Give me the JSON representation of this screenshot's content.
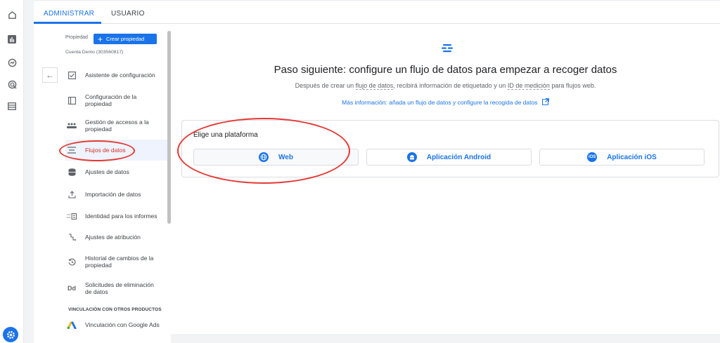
{
  "tabs": {
    "admin": "ADMINISTRAR",
    "user": "USUARIO"
  },
  "property": {
    "label": "Propiedad",
    "create_button": "Crear propiedad",
    "account": "Cuenta Demo (303560817)"
  },
  "menu": [
    {
      "label": "Asistente de configuración",
      "icon": "checkbox-icon"
    },
    {
      "label": "Configuración de la propiedad",
      "icon": "property-window-icon"
    },
    {
      "label": "Gestión de accesos a la propiedad",
      "icon": "people-icon"
    },
    {
      "label": "Flujos de datos",
      "icon": "data-streams-icon"
    },
    {
      "label": "Ajustes de datos",
      "icon": "database-icon"
    },
    {
      "label": "Importación de datos",
      "icon": "upload-icon"
    },
    {
      "label": "Identidad para los informes",
      "icon": "identity-icon"
    },
    {
      "label": "Ajustes de atribución",
      "icon": "attribution-icon"
    },
    {
      "label": "Historial de cambios de la propiedad",
      "icon": "history-icon"
    },
    {
      "label": "Solicitudes de eliminación de datos",
      "icon": "dd-icon"
    }
  ],
  "linking": {
    "section_title": "VINCULACIÓN CON OTROS PRODUCTOS",
    "google_ads": "Vinculación con Google Ads"
  },
  "main": {
    "headline": "Paso siguiente: configure un flujo de datos para empezar a recoger datos",
    "sub_before": "Después de crear un ",
    "sub_term1": "flujo de datos",
    "sub_middle": ", recibirá información de etiquetado y un ",
    "sub_term2": "ID de medición",
    "sub_after": " para flujos web.",
    "more_link": "Más información: añada un flujo de datos y configure la recogida de datos",
    "platform_title": "Elige una plataforma",
    "platforms": {
      "web": "Web",
      "android": "Aplicación Android",
      "ios": "Aplicación iOS",
      "ios_badge": "iOS"
    }
  },
  "colors": {
    "accent": "#1a73e8",
    "annotation": "#e53935"
  }
}
